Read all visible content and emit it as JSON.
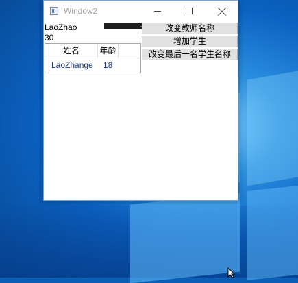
{
  "window": {
    "title": "Window2"
  },
  "teacher": {
    "name": "LaoZhao",
    "age": "30"
  },
  "buttons": {
    "change_teacher": "改变教师名称",
    "add_student": "增加学生",
    "change_last_student": "改变最后一名学生名称"
  },
  "students_grid": {
    "columns": [
      "姓名",
      "年龄"
    ],
    "rows": [
      {
        "name": "LaoZhange",
        "age": "18"
      }
    ]
  },
  "icons": {
    "app": "app-window-icon",
    "minimize": "minimize-icon",
    "maximize": "maximize-icon",
    "close": "close-icon",
    "cursor": "mouse-pointer-icon"
  },
  "colors": {
    "desktop": "#0b62c2",
    "window_bg": "#ffffff",
    "button_bg": "#e1e1e1",
    "cell_text": "#1a3a80"
  }
}
